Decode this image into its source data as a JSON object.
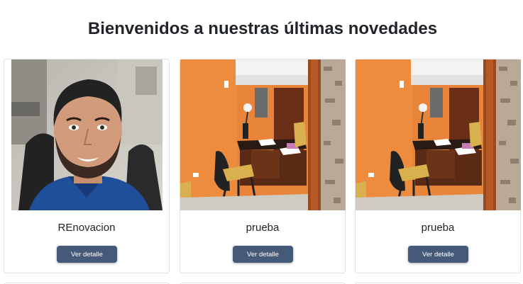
{
  "page": {
    "title": "Bienvenidos a nuestras últimas novedades"
  },
  "products": [
    {
      "title": "REnovacion",
      "button_label": "Ver detalle",
      "image": "man-portrait-photo"
    },
    {
      "title": "prueba",
      "button_label": "Ver detalle",
      "image": "office-desk-photo"
    },
    {
      "title": "prueba",
      "button_label": "Ver detalle",
      "image": "office-desk-photo"
    }
  ],
  "colors": {
    "button": "#455a78",
    "wall": "#e8853a",
    "card_border": "#dee2e6"
  }
}
